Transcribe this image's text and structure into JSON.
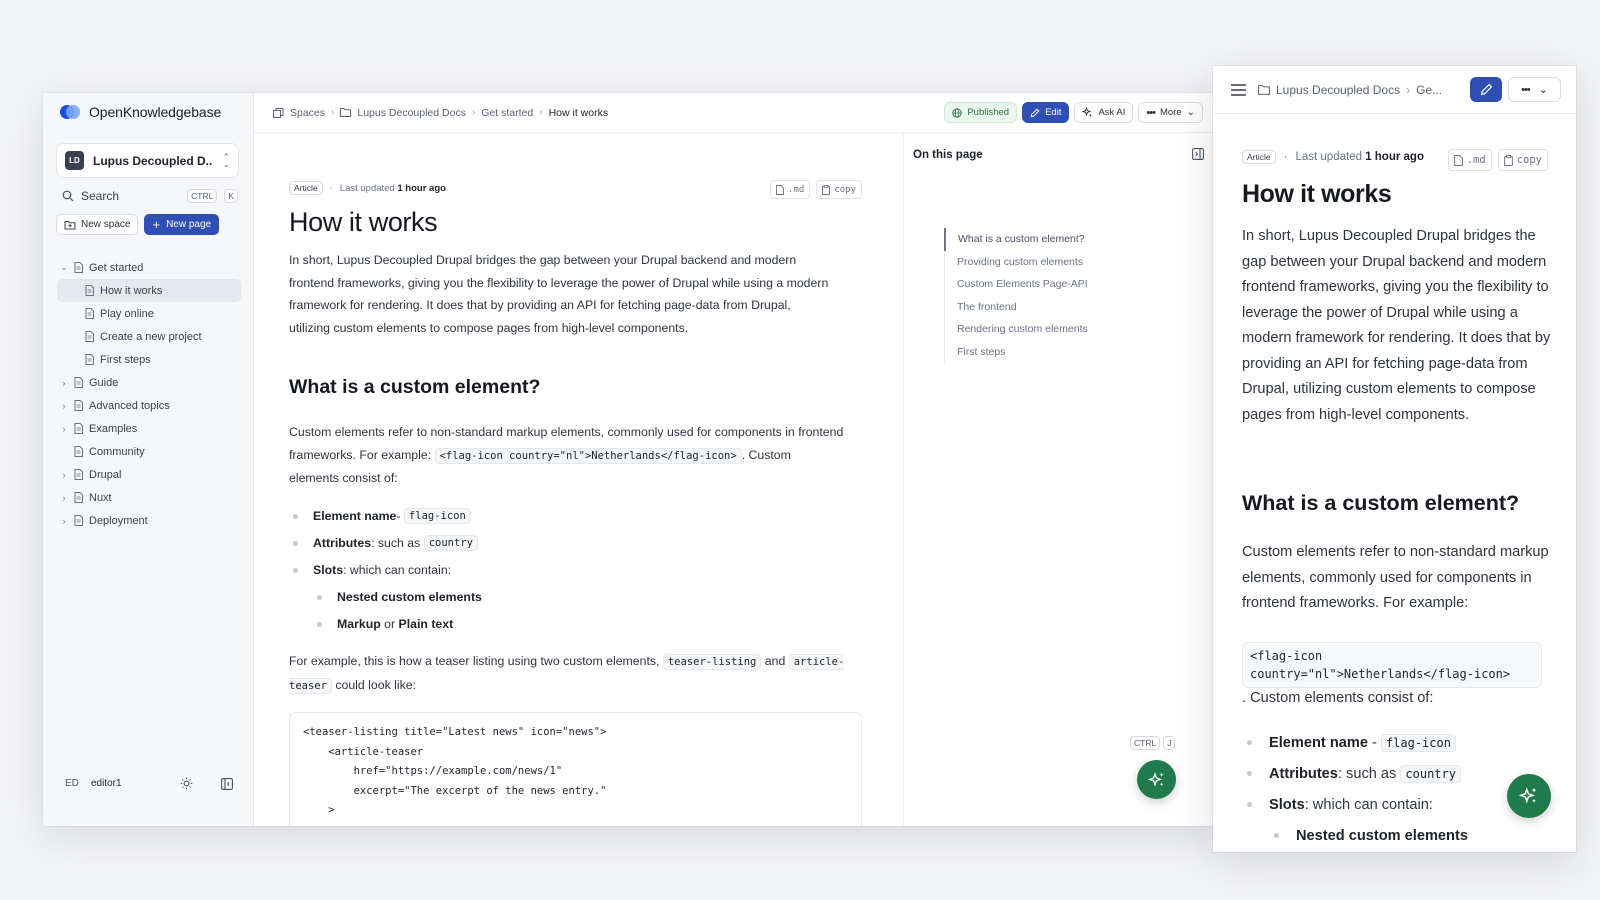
{
  "brand": {
    "name": "OpenKnowledgebase"
  },
  "space": {
    "initials": "LD",
    "name": "Lupus Decoupled D..."
  },
  "search": {
    "label": "Search",
    "kbd1": "CTRL",
    "kbd2": "K"
  },
  "sidebar_buttons": {
    "new_space": "New space",
    "new_page": "New page"
  },
  "tree": [
    {
      "label": "Get started",
      "expanded": true
    },
    {
      "label": "How it works",
      "child": true,
      "active": true
    },
    {
      "label": "Play online",
      "child": true
    },
    {
      "label": "Create a new project",
      "child": true
    },
    {
      "label": "First steps",
      "child": true
    },
    {
      "label": "Guide"
    },
    {
      "label": "Advanced topics"
    },
    {
      "label": "Examples"
    },
    {
      "label": "Community"
    },
    {
      "label": "Drupal"
    },
    {
      "label": "Nuxt"
    },
    {
      "label": "Deployment"
    }
  ],
  "footer": {
    "initials": "ED",
    "user": "editor1"
  },
  "breadcrumb": {
    "spaces": "Spaces",
    "space": "Lupus Decoupled Docs",
    "section": "Get started",
    "page": "How it works"
  },
  "toolbar": {
    "published": "Published",
    "edit": "Edit",
    "ask_ai": "Ask AI",
    "more": "More"
  },
  "meta": {
    "tag": "Article",
    "dot": "·",
    "updated_prefix": "Last updated",
    "updated_value": "1 hour ago",
    "md": ".md",
    "copy": "copy"
  },
  "article": {
    "title": "How it works",
    "intro": "In short, Lupus Decoupled Drupal bridges the gap between your Drupal backend and modern frontend frameworks, giving you the flexibility to leverage the power of Drupal while using a modern framework for rendering. It does that by providing an API for fetching page-data from Drupal, utilizing custom elements to compose pages from high-level components.",
    "h2": "What is a custom element?",
    "p2_a": "Custom elements refer to non-standard markup elements, commonly used for components in frontend frameworks. For example:",
    "p2_code": "<flag-icon country=\"nl\">Netherlands</flag-icon>",
    "p2_b": ". Custom elements consist of:",
    "m_p2_b": ". Custom elements consist of:",
    "li1_b": "Element name",
    "li1_sep": " - ",
    "li1_code": "flag-icon",
    "li2_b": "Attributes",
    "li2_t": ": such as",
    "li2_code": "country",
    "li3_b": "Slots",
    "li3_t": ": which can contain:",
    "li4_b": "Nested custom elements",
    "li5_b1": "Markup",
    "li5_t": " or ",
    "li5_b2": "Plain text",
    "p3_a": "For example, this is how a teaser listing using two custom elements,",
    "p3_code1": "teaser-listing",
    "p3_and": " and",
    "p3_code2": "article-teaser",
    "p3_b": " could look like:",
    "code": "<teaser-listing title=\"Latest news\" icon=\"news\">\n    <article-teaser\n        href=\"https://example.com/news/1\"\n        excerpt=\"The excerpt of the news entry.\"\n    >"
  },
  "toc": {
    "title": "On this page",
    "items": [
      "What is a custom element?",
      "Providing custom elements",
      "Custom Elements Page-API",
      "The frontend",
      "Rendering custom elements",
      "First steps"
    ]
  },
  "shortcut": {
    "k1": "CTRL",
    "k2": "J"
  },
  "mobile": {
    "crumb_space": "Lupus Decoupled Docs",
    "crumb_more": "Ge..."
  },
  "colors": {
    "accent": "#2f4fb4",
    "fab": "#1f7a4c",
    "published_bg": "#eaf6ee"
  }
}
